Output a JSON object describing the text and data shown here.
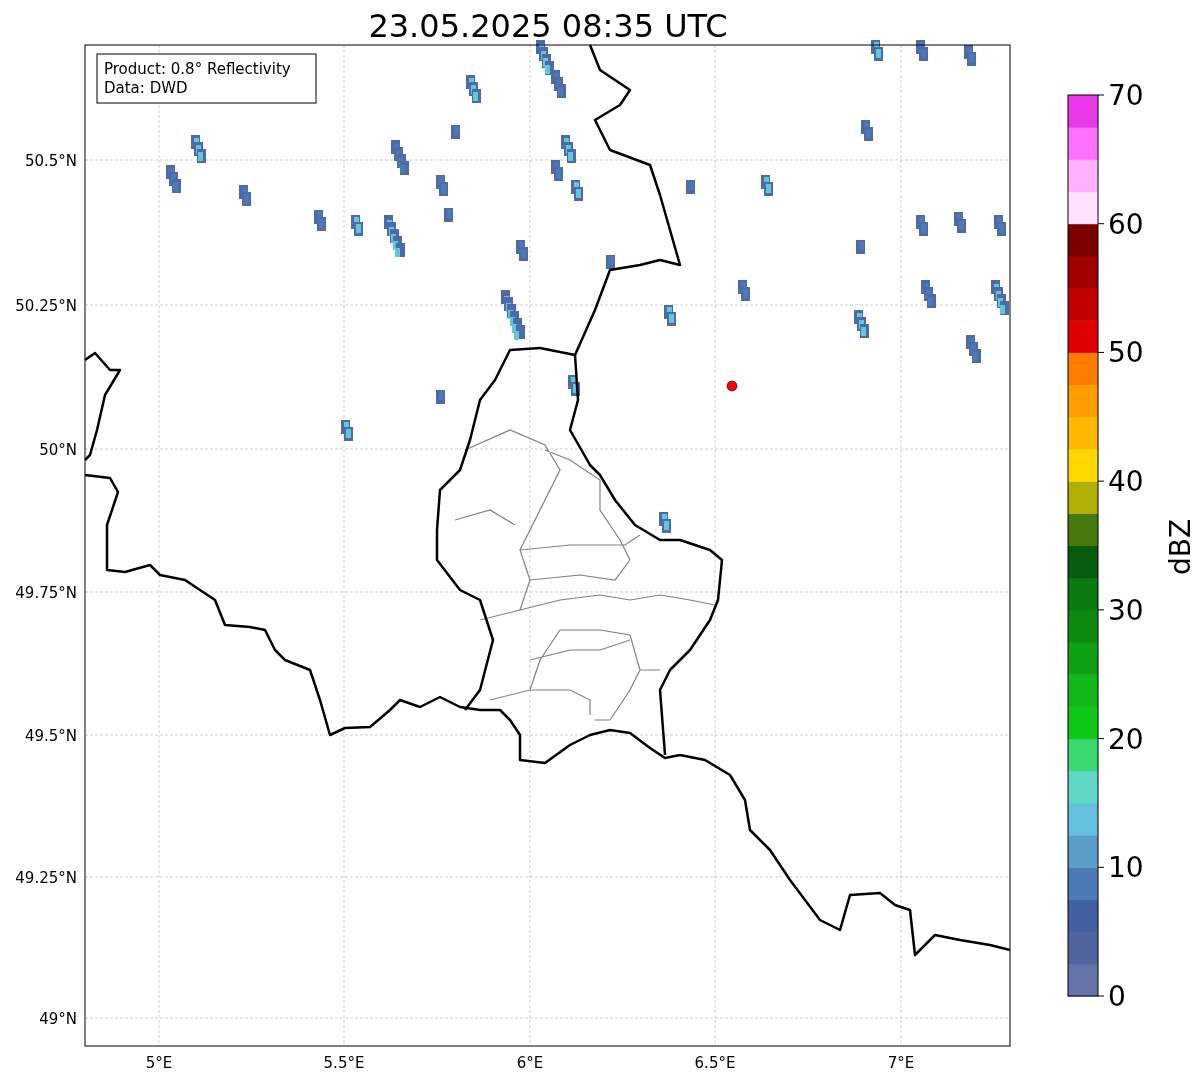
{
  "title": "23.05.2025 08:35 UTC",
  "info_box": {
    "lines": [
      "Product: 0.8° Reflectivity",
      "Data: DWD"
    ]
  },
  "map": {
    "x_tick_labels": [
      "5°E",
      "5.5°E",
      "6°E",
      "6.5°E",
      "7°E"
    ],
    "y_tick_labels": [
      "50.5°N",
      "50.25°N",
      "50°N",
      "49.75°N",
      "49.5°N",
      "49.25°N",
      "49°N"
    ]
  },
  "colorbar": {
    "label": "dBZ",
    "tick_labels": [
      "70",
      "60",
      "50",
      "40",
      "30",
      "20",
      "10",
      "0"
    ],
    "bands": [
      {
        "color": "#6474a8"
      },
      {
        "color": "#5065a0"
      },
      {
        "color": "#4360a2"
      },
      {
        "color": "#4b7ab4"
      },
      {
        "color": "#5a9ec8"
      },
      {
        "color": "#64c0dc"
      },
      {
        "color": "#60d8c8"
      },
      {
        "color": "#3cd870"
      },
      {
        "color": "#10c818"
      },
      {
        "color": "#10b818"
      },
      {
        "color": "#10a014"
      },
      {
        "color": "#0c8a10"
      },
      {
        "color": "#0a7a10"
      },
      {
        "color": "#085a0c"
      },
      {
        "color": "#467a0c"
      },
      {
        "color": "#b0b004"
      },
      {
        "color": "#ffd800"
      },
      {
        "color": "#ffb800"
      },
      {
        "color": "#ff9c00"
      },
      {
        "color": "#ff7c00"
      },
      {
        "color": "#e00000"
      },
      {
        "color": "#c00000"
      },
      {
        "color": "#a00000"
      },
      {
        "color": "#7c0000"
      },
      {
        "color": "#ffe0ff"
      },
      {
        "color": "#ffb0ff"
      },
      {
        "color": "#ff70ff"
      },
      {
        "color": "#e838e8"
      }
    ]
  }
}
